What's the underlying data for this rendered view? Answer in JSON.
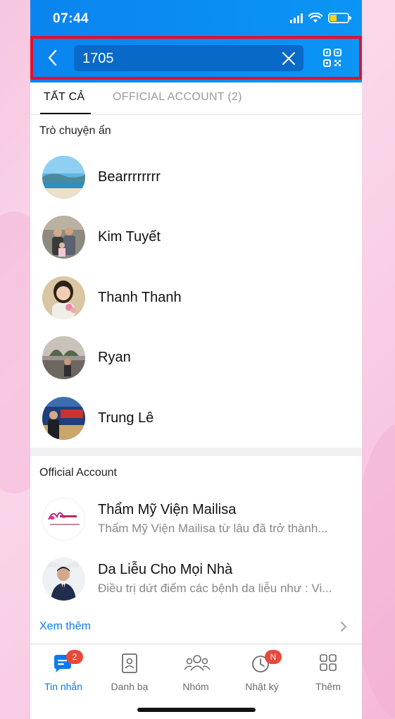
{
  "status_bar": {
    "time": "07:44"
  },
  "search": {
    "value": "1705"
  },
  "tabs": [
    {
      "label": "TẤT CẢ",
      "active": true
    },
    {
      "label": "OFFICIAL ACCOUNT (2)",
      "active": false
    }
  ],
  "hidden_chats": {
    "title": "Trò chuyện ẩn",
    "items": [
      {
        "name": "Bearrrrrrrr"
      },
      {
        "name": "Kim Tuyết"
      },
      {
        "name": "Thanh Thanh"
      },
      {
        "name": "Ryan"
      },
      {
        "name": "Trung Lê"
      }
    ]
  },
  "official_accounts": {
    "title": "Official Account",
    "items": [
      {
        "name": "Thẩm Mỹ Viện Mailisa",
        "subtitle": "Thẩm Mỹ Viện Mailisa từ lâu đã trở thành..."
      },
      {
        "name": "Da Liễu Cho Mọi Nhà",
        "subtitle": "Điều trị dứt điểm các bệnh da liễu như : Vi..."
      }
    ],
    "see_more": "Xem thêm"
  },
  "bottom_nav": [
    {
      "label": "Tin nhắn",
      "icon": "chat-icon",
      "badge": "2",
      "active": true
    },
    {
      "label": "Danh bạ",
      "icon": "contacts-icon",
      "badge": "",
      "active": false
    },
    {
      "label": "Nhóm",
      "icon": "group-icon",
      "badge": "",
      "active": false
    },
    {
      "label": "Nhật ký",
      "icon": "clock-icon",
      "badge": "N",
      "active": false
    },
    {
      "label": "Thêm",
      "icon": "grid-icon",
      "badge": "",
      "active": false
    }
  ],
  "colors": {
    "header_blue": "#0a84f0",
    "search_field": "#0869c9",
    "highlight_border": "#e3102d",
    "accent": "#0a7bec",
    "badge": "#e8493a"
  }
}
